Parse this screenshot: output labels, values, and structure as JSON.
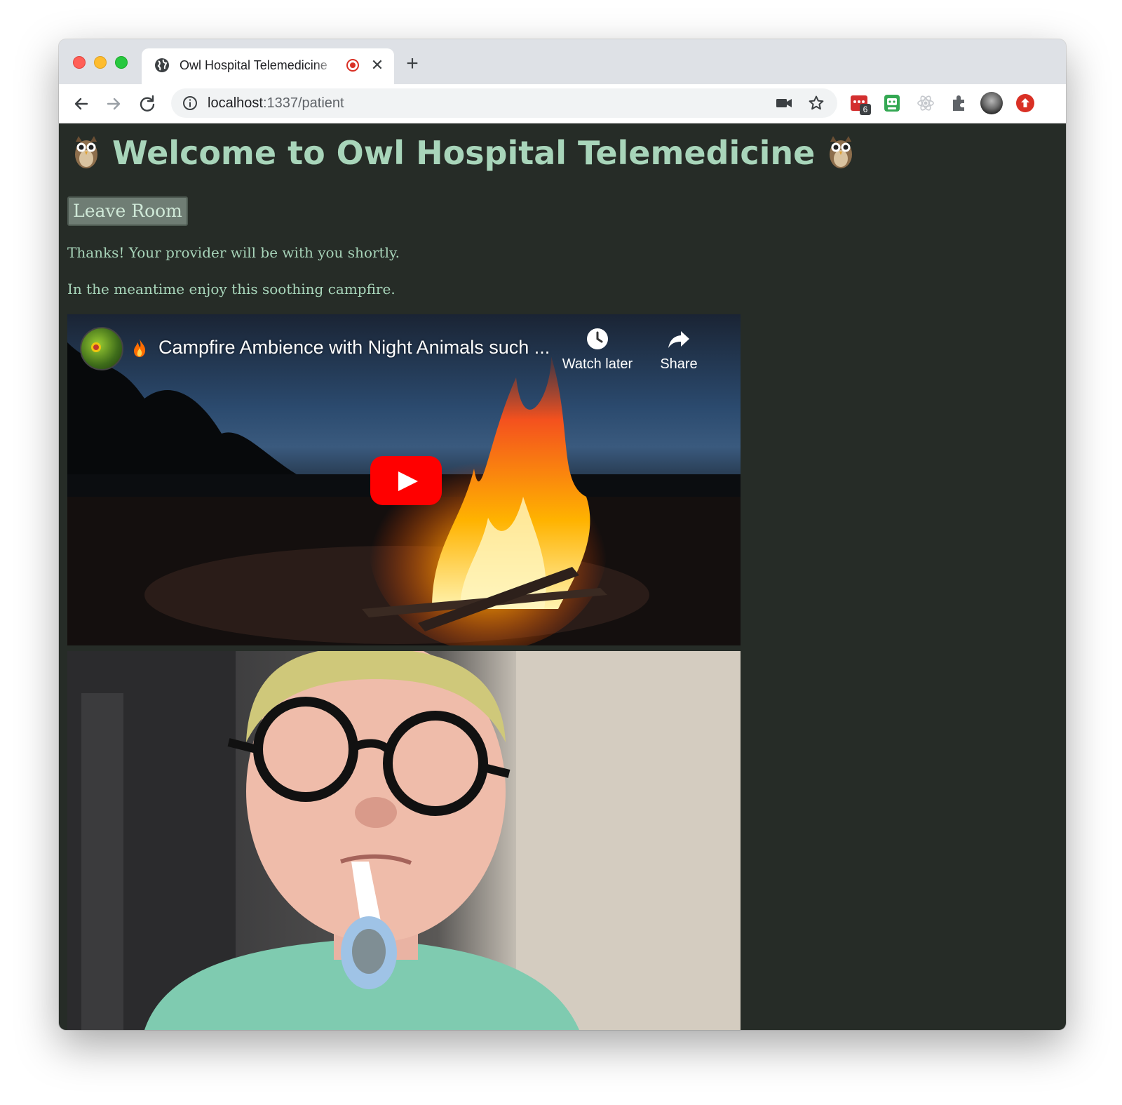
{
  "browser": {
    "tab_title": "Owl Hospital Telemedicine",
    "url_host": "localhost",
    "url_path": ":1337/patient",
    "extension_badge": "6"
  },
  "page": {
    "heading": "Welcome to Owl Hospital Telemedicine",
    "leave_button": "Leave Room",
    "message_1": "Thanks! Your provider will be with you shortly.",
    "message_2": "In the meantime enjoy this soothing campfire."
  },
  "video": {
    "title": "Campfire Ambience with Night Animals such ...",
    "watch_later_label": "Watch later",
    "share_label": "Share"
  },
  "colors": {
    "page_background": "#262c27",
    "heading_text": "#a8d5ba",
    "button_background": "#6f7d74",
    "play_button": "#ff0000"
  }
}
